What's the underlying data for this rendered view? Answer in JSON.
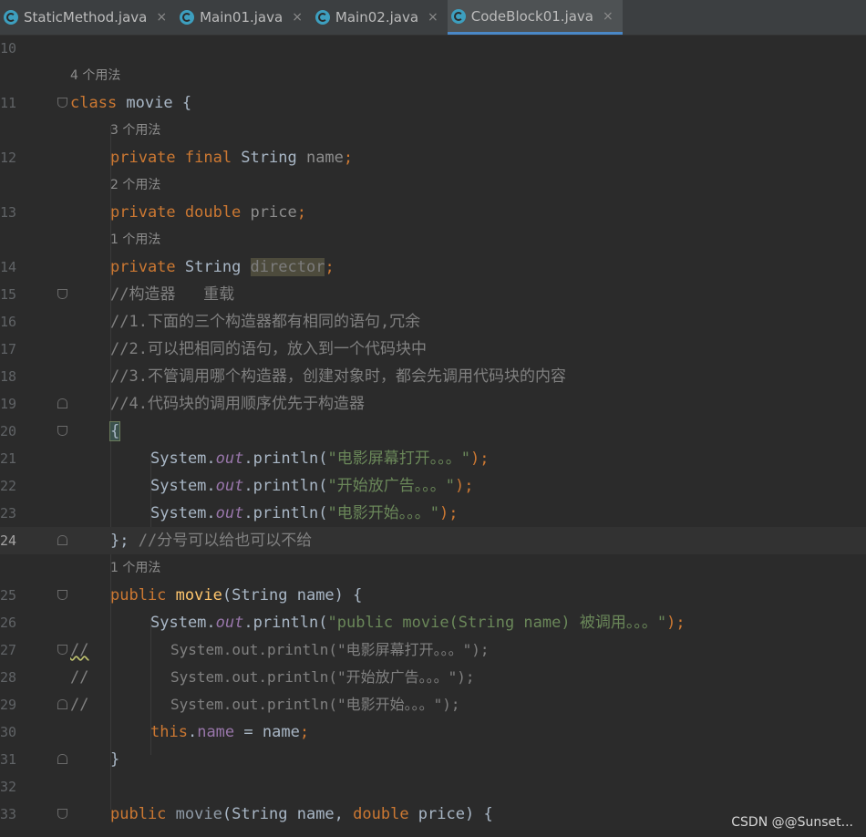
{
  "tabs": [
    {
      "label": "StaticMethod.java",
      "active": false
    },
    {
      "label": "Main01.java",
      "active": false
    },
    {
      "label": "Main02.java",
      "active": false
    },
    {
      "label": "CodeBlock01.java",
      "active": true
    }
  ],
  "tab_close_glyph": "×",
  "usage_hints": {
    "h11": "4 个用法",
    "h12": "3 个用法",
    "h13": "2 个用法",
    "h14": "1 个用法",
    "h25": "1 个用法"
  },
  "line_numbers": [
    "10",
    "11",
    "12",
    "13",
    "14",
    "15",
    "16",
    "17",
    "18",
    "19",
    "20",
    "21",
    "22",
    "23",
    "24",
    "25",
    "26",
    "27",
    "28",
    "29",
    "30",
    "31",
    "32",
    "33"
  ],
  "current_line": "24",
  "code": {
    "l11": {
      "kw": "class",
      "rest": " movie {"
    },
    "l12": {
      "kw": "private final",
      "type": " String ",
      "field": "name",
      "semi": ";"
    },
    "l13": {
      "kw": "private double",
      "field": " price",
      "semi": ";"
    },
    "l14": {
      "kw": "private",
      "type": " String ",
      "field": "director",
      "semi": ";"
    },
    "l15": "//构造器   重载",
    "l16": "//1.下面的三个构造器都有相同的语句,冗余",
    "l17": "//2.可以把相同的语句，放入到一个代码块中",
    "l18": "//3.不管调用哪个构造器，创建对象时，都会先调用代码块的内容",
    "l19": "//4.代码块的调用顺序优先于构造器",
    "l20": "{",
    "l21": {
      "pre": "System.",
      "out": "out",
      "mid": ".println(",
      "str": "\"电影屏幕打开。。。\"",
      "end": ");"
    },
    "l22": {
      "pre": "System.",
      "out": "out",
      "mid": ".println(",
      "str": "\"开始放广告。。。\"",
      "end": ");"
    },
    "l23": {
      "pre": "System.",
      "out": "out",
      "mid": ".println(",
      "str": "\"电影开始。。。\"",
      "end": ");"
    },
    "l24": {
      "code": "};",
      "comment": " //分号可以给也可以不给"
    },
    "l25": {
      "kw": "public",
      "name": " movie",
      "rest": "(String name) {"
    },
    "l26": {
      "pre": "System.",
      "out": "out",
      "mid": ".println(",
      "str": "\"public movie(String name) 被调用。。。\"",
      "end": ");"
    },
    "l27": {
      "mark": "//",
      "body": "System.out.println(\"电影屏幕打开。。。\");"
    },
    "l28": {
      "mark": "//",
      "body": "System.out.println(\"开始放广告。。。\");"
    },
    "l29": {
      "mark": "//",
      "body": "System.out.println(\"电影开始。。。\");"
    },
    "l30": {
      "kw": "this",
      "dot": ".",
      "field": "name",
      "rest": " = name",
      "semi": ";"
    },
    "l31": "}",
    "l33": {
      "kw": "public",
      "name": " movie",
      "p1": "(String name, ",
      "kw2": "double",
      "p2": " price) {"
    }
  },
  "watermark": "CSDN @@Sunset..."
}
